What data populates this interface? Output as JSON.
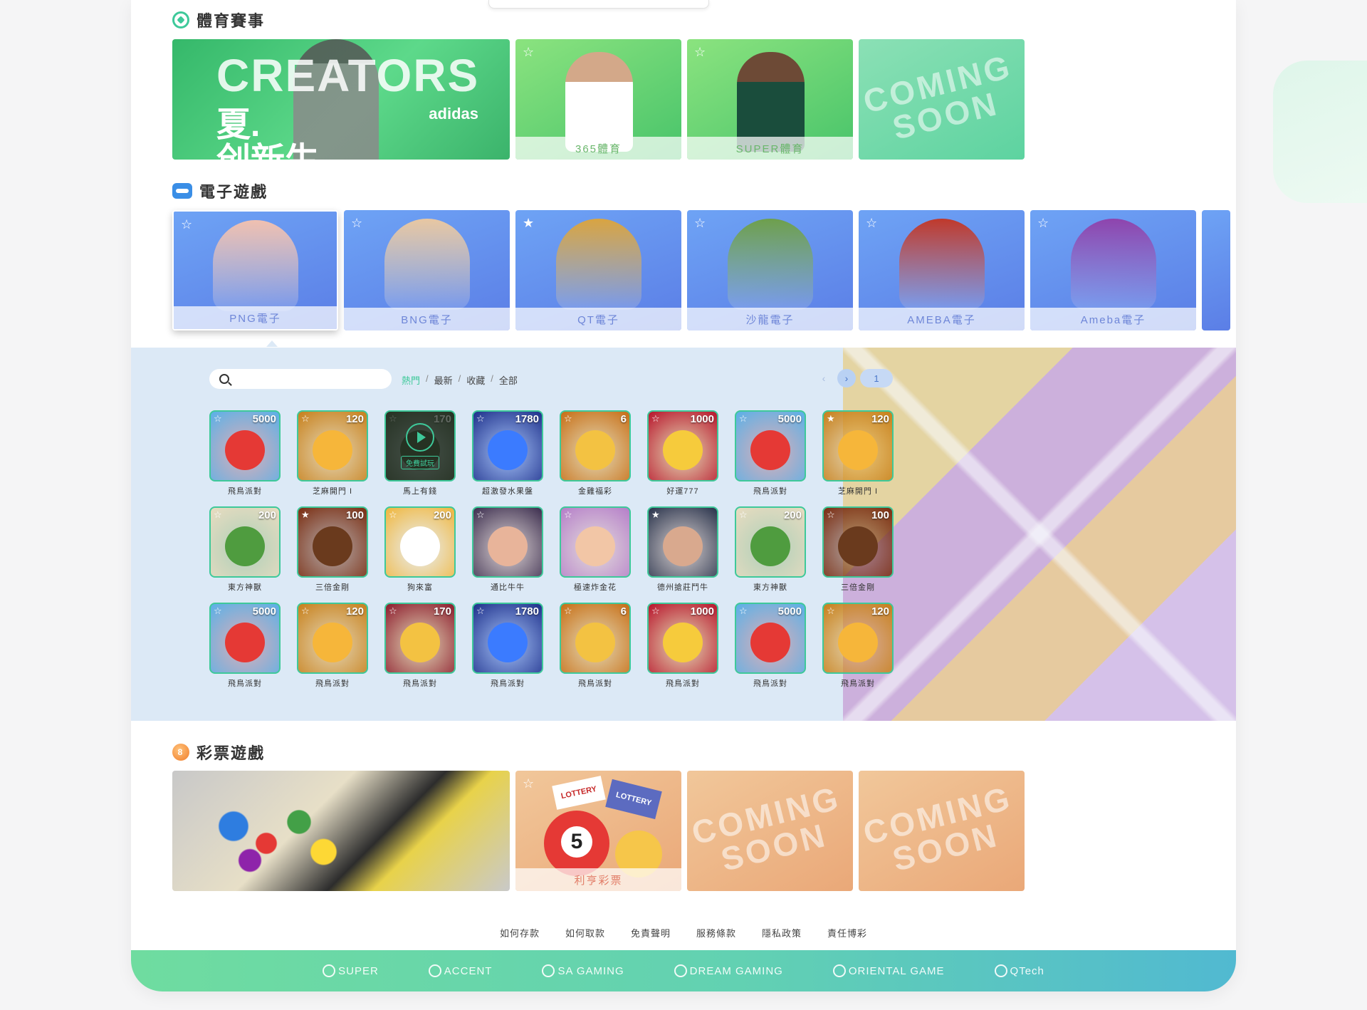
{
  "sections": {
    "sports": {
      "title": "體育賽事"
    },
    "egames": {
      "title": "電子遊戲"
    },
    "lottery": {
      "title": "彩票遊戲"
    }
  },
  "sports_cards": [
    {
      "label": "",
      "promo_big": "CREATORS",
      "promo_cn": "夏.\n创新生",
      "promo_brand": "adidas"
    },
    {
      "label": "365體育"
    },
    {
      "label": "SUPER體育"
    },
    {
      "label": "COMING SOON",
      "coming": [
        "COMING",
        "SOON"
      ]
    }
  ],
  "egame_cards": [
    {
      "label": "PNG電子",
      "color": "#f0c0b0",
      "starred": false
    },
    {
      "label": "BNG電子",
      "color": "#e8c7a2",
      "starred": false
    },
    {
      "label": "QT電子",
      "color": "#d9a441",
      "starred": true
    },
    {
      "label": "沙龍電子",
      "color": "#6e9f4c",
      "starred": false
    },
    {
      "label": "AMEBA電子",
      "color": "#c0392b",
      "starred": false
    },
    {
      "label": "Ameba電子",
      "color": "#8e44ad",
      "starred": false
    }
  ],
  "game_lobby": {
    "search_value": "",
    "filters": [
      "熱門",
      "最新",
      "收藏",
      "全部"
    ],
    "active_filter": "熱門",
    "page": "1",
    "prev_icon": "chevron-left-icon",
    "next_icon": "chevron-right-icon",
    "play_label": "免費試玩",
    "games": [
      {
        "name": "飛鳥派對",
        "num": "5000",
        "bg": "#59b0e8",
        "blob": "#e53935",
        "starred": false
      },
      {
        "name": "芝麻開門 I",
        "num": "120",
        "bg": "#c77f1a",
        "blob": "#f6b63a",
        "starred": false
      },
      {
        "name": "馬上有錢",
        "num": "170",
        "bg": "#3a4a30",
        "blob": "#3a4a30",
        "starred": false,
        "play": true
      },
      {
        "name": "超激發水果盤",
        "num": "1780",
        "bg": "#1d2f8a",
        "blob": "#3b7bff",
        "starred": false
      },
      {
        "name": "金雞福彩",
        "num": "6",
        "bg": "#c76d14",
        "blob": "#f3c242",
        "starred": false
      },
      {
        "name": "好運777",
        "num": "1000",
        "bg": "#b8132b",
        "blob": "#f6cb3c",
        "starred": false
      },
      {
        "name": "飛鳥派對",
        "num": "5000",
        "bg": "#59b0e8",
        "blob": "#e53935",
        "starred": false
      },
      {
        "name": "芝麻開門 I",
        "num": "120",
        "bg": "#c77f1a",
        "blob": "#f6b63a",
        "starred": true
      },
      {
        "name": "東方神獸",
        "num": "200",
        "bg": "#e9dcc0",
        "blob": "#4f9c3f",
        "starred": false
      },
      {
        "name": "三倍金剛",
        "num": "100",
        "bg": "#7a2c10",
        "blob": "#6a3a1d",
        "starred": true
      },
      {
        "name": "狗來富",
        "num": "200",
        "bg": "#f0b63c",
        "blob": "#ffffff",
        "starred": false
      },
      {
        "name": "通比牛牛",
        "num": "",
        "bg": "#3b2d4e",
        "blob": "#e8b49a",
        "starred": false
      },
      {
        "name": "極速炸金花",
        "num": "",
        "bg": "#b57ec9",
        "blob": "#f2c6a6",
        "starred": false
      },
      {
        "name": "德州搶莊鬥牛",
        "num": "",
        "bg": "#28324b",
        "blob": "#d9a98e",
        "starred": true
      },
      {
        "name": "東方神獸",
        "num": "200",
        "bg": "#e9dcc0",
        "blob": "#4f9c3f",
        "starred": false
      },
      {
        "name": "三倍金剛",
        "num": "100",
        "bg": "#7a2c10",
        "blob": "#6a3a1d",
        "starred": false
      },
      {
        "name": "飛鳥派對",
        "num": "5000",
        "bg": "#59b0e8",
        "blob": "#e53935",
        "starred": false
      },
      {
        "name": "飛鳥派對",
        "num": "120",
        "bg": "#c77f1a",
        "blob": "#f6b63a",
        "starred": false
      },
      {
        "name": "飛鳥派對",
        "num": "170",
        "bg": "#8c1a2c",
        "blob": "#f3c242",
        "starred": false
      },
      {
        "name": "飛鳥派對",
        "num": "1780",
        "bg": "#1d2f8a",
        "blob": "#3b7bff",
        "starred": false
      },
      {
        "name": "飛鳥派對",
        "num": "6",
        "bg": "#c76d14",
        "blob": "#f3c242",
        "starred": false
      },
      {
        "name": "飛鳥派對",
        "num": "1000",
        "bg": "#b8132b",
        "blob": "#f6cb3c",
        "starred": false
      },
      {
        "name": "飛鳥派對",
        "num": "5000",
        "bg": "#59b0e8",
        "blob": "#e53935",
        "starred": false
      },
      {
        "name": "飛鳥派對",
        "num": "120",
        "bg": "#c77f1a",
        "blob": "#f6b63a",
        "starred": false
      }
    ]
  },
  "lottery_cards": [
    {
      "label": ""
    },
    {
      "label": "利亨彩票",
      "ticket1": "LOTTERY",
      "ticket2": "LOTTERY"
    },
    {
      "label": "COMING SOON",
      "coming": [
        "COMING",
        "SOON"
      ]
    },
    {
      "label": "COMING SOON",
      "coming": [
        "COMING",
        "SOON"
      ]
    }
  ],
  "footer": {
    "links": [
      "如何存款",
      "如何取款",
      "免責聲明",
      "服務條款",
      "隱私政策",
      "責任博彩"
    ],
    "partners": [
      "SUPER",
      "ACCENT",
      "SA GAMING",
      "DREAM GAMING",
      "ORIENTAL GAME",
      "QTech"
    ]
  },
  "colors": {
    "accent": "#3ec99a",
    "lobby_bg": "#dce9f6",
    "footer_start": "#6fdca0",
    "footer_end": "#51b9d1"
  }
}
